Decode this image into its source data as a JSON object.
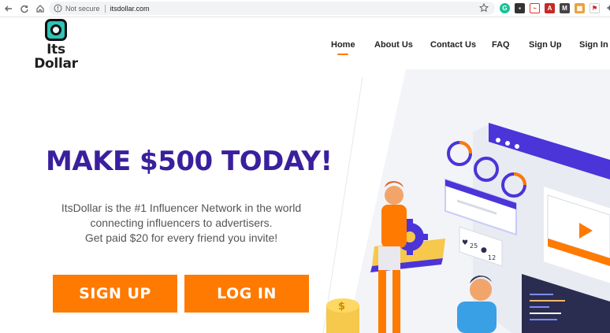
{
  "browser": {
    "security_label": "Not secure",
    "url": "itsdollar.com",
    "extensions": [
      "grammarly-icon",
      "camera-icon",
      "extension-icon",
      "pdf-icon",
      "gmail-icon",
      "puzzle-icon",
      "flag-icon",
      "puzzle-icon",
      "profile-icon"
    ]
  },
  "logo": {
    "line1": "Its",
    "line2": "Dollar"
  },
  "nav": [
    {
      "label": "Home",
      "active": true
    },
    {
      "label": "About Us"
    },
    {
      "label": "Contact Us"
    },
    {
      "label": "FAQ"
    },
    {
      "label": "Sign Up"
    },
    {
      "label": "Sign In"
    }
  ],
  "hero": {
    "title": "MAKE $500 TODAY!",
    "desc_line1": "ItsDollar is the #1 Influencer Network in the world",
    "desc_line2": "connecting influencers to advertisers.",
    "desc_line3": "Get paid $20 for every friend you invite!",
    "signup_label": "SIGN UP",
    "login_label": "LOG IN"
  },
  "illustration": {
    "likes": "25",
    "comments": "12",
    "coin_symbol": "$"
  },
  "colors": {
    "accent": "#ff7a00",
    "brand": "#3a1f9e",
    "teal": "#2ec4b6"
  }
}
